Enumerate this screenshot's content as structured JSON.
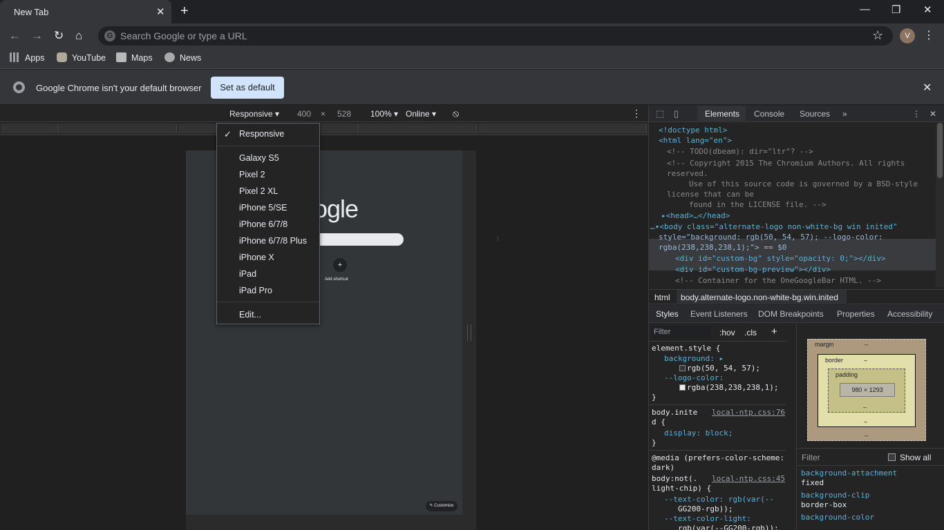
{
  "tab": {
    "title": "New Tab",
    "close": "✕",
    "new": "+"
  },
  "window": {
    "minimize": "—",
    "restore": "❐",
    "close": "✕"
  },
  "nav": {
    "back": "←",
    "forward": "→",
    "reload": "↻",
    "home": "⌂"
  },
  "omnibox": {
    "placeholder": "Search Google or type a URL",
    "g": "G"
  },
  "account": {
    "initial": "V",
    "star": "☆",
    "menu": "⋮"
  },
  "bookmarks": [
    {
      "label": "Apps",
      "icon": "apps-grid-icon",
      "color": "#9aa0a6"
    },
    {
      "label": "YouTube",
      "icon": "youtube-icon",
      "color": "#b0a99a"
    },
    {
      "label": "Maps",
      "icon": "maps-icon",
      "color": "#b9b9b9"
    },
    {
      "label": "News",
      "icon": "news-icon",
      "color": "#a9a9a9"
    }
  ],
  "infobar": {
    "message": "Google Chrome isn't your default browser",
    "button": "Set as default",
    "close": "✕"
  },
  "device_toolbar": {
    "device": "Responsive ▾",
    "width": "400",
    "times": "×",
    "height": "528",
    "zoom": "100% ▾",
    "throttle": "Online ▾",
    "rotate": "⦸",
    "more": "⋮"
  },
  "dropdown": {
    "selected": "Responsive",
    "check": "✓",
    "devices": [
      "Galaxy S5",
      "Pixel 2",
      "Pixel 2 XL",
      "iPhone 5/SE",
      "iPhone 6/7/8",
      "iPhone 6/7/8 Plus",
      "iPhone X",
      "iPad",
      "iPad Pro"
    ],
    "edit": "Edit..."
  },
  "preview": {
    "logo": "ogle",
    "plus": "+",
    "shortcut": "Add shortcut",
    "customize": "✎ Customize",
    "mic": "⁞"
  },
  "devtools": {
    "tabs": {
      "elements": "Elements",
      "console": "Console",
      "sources": "Sources",
      "more": "»",
      "menu": "⋮",
      "close": "✕"
    },
    "dom": [
      "<!doctype html>",
      "<html lang=\"en\">",
      "<!-- TODO(dbeam): dir=\"ltr\"? -->",
      "<!-- Copyright 2015 The Chromium Authors. All rights",
      "reserved.",
      "Use of this source code is governed by a BSD-style",
      "license that can be",
      "found in the LICENSE file. -->",
      "▸<head>…</head>",
      "…▾<body class=\"alternate-logo non-white-bg win inited\"",
      "style=\"background: rgb(50, 54, 57); --logo-color:",
      "rgba(238,238,238,1);\"> == $0",
      "<div id=\"custom-bg\" style=\"opacity: 0;\"></div>",
      "<div id=\"custom-bg-preview\"></div>",
      "<!-- Container for the OneGoogleBar HTML. -->"
    ],
    "breadcrumbs": [
      "html",
      "body.alternate-logo.non-white-bg.win.inited"
    ],
    "subtabs": [
      "Styles",
      "Event Listeners",
      "DOM Breakpoints",
      "Properties",
      "Accessibility"
    ],
    "filter": {
      "placeholder": "Filter",
      "hov": ":hov",
      "cls": ".cls",
      "plus": "+"
    },
    "styles": [
      "element.style {",
      "background: ▸",
      "rgb(50, 54, 57);",
      "--logo-color:",
      "rgba(238,238,238,1);",
      "}",
      "body.inite",
      "local-ntp.css:76",
      "d {",
      "display: block;",
      "}",
      "@media (prefers-color-scheme:",
      "dark)",
      "body:not(.",
      "local-ntp.css:45",
      "light-chip) {",
      "--text-color: rgb(var(--",
      "GG200-rgb));",
      "--text-color-light:",
      "rgb(var(--GG200-rgb));"
    ],
    "swatches": {
      "bg": "#323639",
      "logo": "#eeeeee"
    },
    "boxmodel": {
      "margin": "margin",
      "border": "border",
      "padding": "padding",
      "content": "980 × 1293",
      "dash": "–"
    },
    "computed_filter": "Filter",
    "show_all": "Show all",
    "computed": [
      {
        "prop": "background-attachment",
        "value": "fixed"
      },
      {
        "prop": "background-clip",
        "value": "border-box"
      },
      {
        "prop": "background-color",
        "value": ""
      }
    ]
  }
}
